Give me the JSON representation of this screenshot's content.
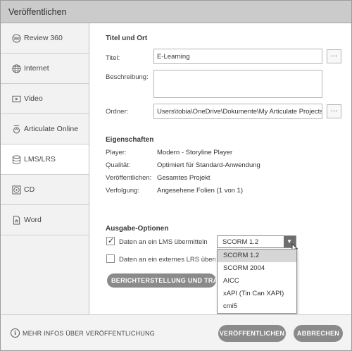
{
  "window": {
    "title": "Veröffentlichen"
  },
  "sidebar": {
    "items": [
      {
        "label": "Review 360",
        "icon": "review-360-icon"
      },
      {
        "label": "Internet",
        "icon": "globe-icon"
      },
      {
        "label": "Video",
        "icon": "video-icon"
      },
      {
        "label": "Articulate Online",
        "icon": "upload-icon"
      },
      {
        "label": "LMS/LRS",
        "icon": "database-icon",
        "active": true
      },
      {
        "label": "CD",
        "icon": "cd-icon"
      },
      {
        "label": "Word",
        "icon": "word-document-icon"
      }
    ]
  },
  "title_and_location": {
    "heading": "Titel und Ort",
    "title_label": "Titel:",
    "title_value": "E-Learning",
    "description_label": "Beschreibung:",
    "description_value": "",
    "folder_label": "Ordner:",
    "folder_value": "Users\\tobia\\OneDrive\\Dokumente\\My Articulate Projects",
    "browse_label": "..."
  },
  "properties": {
    "heading": "Eigenschaften",
    "rows": [
      {
        "label": "Player:",
        "value": "Modern - Storyline Player"
      },
      {
        "label": "Qualität:",
        "value": "Optimiert für Standard-Anwendung"
      },
      {
        "label": "Veröffentlichen:",
        "value": "Gesamtes Projekt"
      },
      {
        "label": "Verfolgung:",
        "value": "Angesehene Folien (1 von 1)"
      }
    ]
  },
  "output": {
    "heading": "Ausgabe-Optionen",
    "lms_checkbox_label": "Daten an ein LMS übermitteln",
    "lms_checked": true,
    "lrs_checkbox_label": "Daten an ein externes LRS übermitteln",
    "lrs_checked": false,
    "standard_selected": "SCORM 1.2",
    "standard_options": [
      "SCORM 1.2",
      "SCORM 2004",
      "AICC",
      "xAPI (Tin Can XAPI)",
      "cmi5"
    ],
    "reporting_button": "BERICHTERSTELLUNG UND TRACKING"
  },
  "footer": {
    "info_link": "MEHR INFOS ÜBER VERÖFFENTLICHUNG",
    "publish_button": "VERÖFFENTLICHEN",
    "cancel_button": "ABBRECHEN"
  },
  "colors": {
    "button_bg": "#8a8a8a",
    "selected_option_bg": "#d6d6d6",
    "titlebar_bg": "#cbcbcb"
  }
}
